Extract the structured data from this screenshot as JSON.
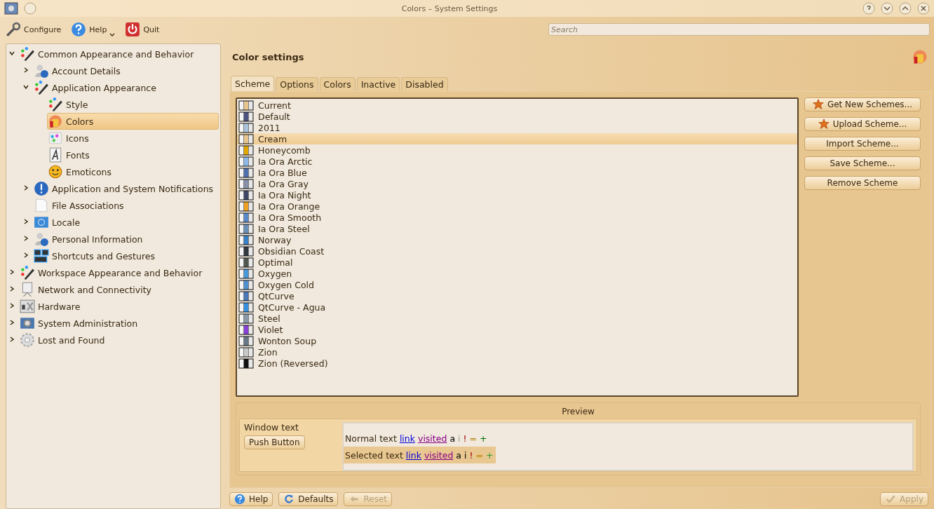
{
  "window": {
    "title": "Colors – System Settings"
  },
  "toolbar": [
    {
      "label": "Configure",
      "kind": "wrench",
      "has_menu": false
    },
    {
      "label": "Help",
      "kind": "help",
      "has_menu": true
    },
    {
      "label": "Quit",
      "kind": "power",
      "has_menu": false
    }
  ],
  "search": {
    "placeholder": "Search"
  },
  "tree": [
    {
      "label": "Common Appearance and Behavior",
      "kind": "pencil",
      "expanded": true,
      "selected": false,
      "children": [
        {
          "label": "Account Details",
          "kind": "user",
          "expanded": false,
          "selected": false
        },
        {
          "label": "Application Appearance",
          "kind": "pencil",
          "expanded": true,
          "selected": false,
          "children": [
            {
              "label": "Style",
              "kind": "pencil",
              "selected": false
            },
            {
              "label": "Colors",
              "kind": "paint",
              "selected": true
            },
            {
              "label": "Icons",
              "kind": "dots",
              "selected": false
            },
            {
              "label": "Fonts",
              "kind": "font",
              "selected": false
            },
            {
              "label": "Emoticons",
              "kind": "smiley",
              "selected": false
            }
          ]
        },
        {
          "label": "Application and System Notifications",
          "kind": "info",
          "expanded": false,
          "selected": false
        },
        {
          "label": "File Associations",
          "kind": "file",
          "selected": false
        },
        {
          "label": "Locale",
          "kind": "flag",
          "expanded": false,
          "selected": false
        },
        {
          "label": "Personal Information",
          "kind": "user",
          "expanded": false,
          "selected": false
        },
        {
          "label": "Shortcuts and Gestures",
          "kind": "keys",
          "expanded": false,
          "selected": false
        }
      ]
    },
    {
      "label": "Workspace Appearance and Behavior",
      "kind": "pencil",
      "expanded": false,
      "selected": false
    },
    {
      "label": "Network and Connectivity",
      "kind": "network",
      "expanded": false,
      "selected": false
    },
    {
      "label": "Hardware",
      "kind": "hardware",
      "expanded": false,
      "selected": false
    },
    {
      "label": "System Administration",
      "kind": "admin",
      "expanded": false,
      "selected": false
    },
    {
      "label": "Lost and Found",
      "kind": "gear",
      "expanded": false,
      "selected": false
    }
  ],
  "page": {
    "title": "Color settings"
  },
  "tabs": [
    {
      "label": "Scheme",
      "selected": true
    },
    {
      "label": "Options",
      "selected": false
    },
    {
      "label": "Colors",
      "selected": false
    },
    {
      "label": "Inactive",
      "selected": false
    },
    {
      "label": "Disabled",
      "selected": false
    }
  ],
  "schemes": [
    {
      "name": "Current",
      "color": "#e8c48c",
      "selected": false
    },
    {
      "name": "Default",
      "color": "#4a5280",
      "selected": false
    },
    {
      "name": "2011",
      "color": "#a8c4dc",
      "selected": false
    },
    {
      "name": "Cream",
      "color": "#e8c48c",
      "selected": true
    },
    {
      "name": "Honeycomb",
      "color": "#e0a800",
      "selected": false
    },
    {
      "name": "Ia Ora Arctic",
      "color": "#8cb8e8",
      "selected": false
    },
    {
      "name": "Ia Ora Blue",
      "color": "#5070b0",
      "selected": false
    },
    {
      "name": "Ia Ora Gray",
      "color": "#8890a8",
      "selected": false
    },
    {
      "name": "Ia Ora Night",
      "color": "#404868",
      "selected": false
    },
    {
      "name": "Ia Ora Orange",
      "color": "#f0a020",
      "selected": false
    },
    {
      "name": "Ia Ora Smooth",
      "color": "#5888c8",
      "selected": false
    },
    {
      "name": "Ia Ora Steel",
      "color": "#6890b8",
      "selected": false
    },
    {
      "name": "Norway",
      "color": "#3880c8",
      "selected": false
    },
    {
      "name": "Obsidian Coast",
      "color": "#303840",
      "selected": false
    },
    {
      "name": "Optimal",
      "color": "#505850",
      "selected": false
    },
    {
      "name": "Oxygen",
      "color": "#4898d8",
      "selected": false
    },
    {
      "name": "Oxygen Cold",
      "color": "#5090d0",
      "selected": false
    },
    {
      "name": "QtCurve",
      "color": "#4878b8",
      "selected": false
    },
    {
      "name": "QtCurve - Agua",
      "color": "#3890e0",
      "selected": false
    },
    {
      "name": "Steel",
      "color": "#8898a8",
      "selected": false
    },
    {
      "name": "Violet",
      "color": "#8840d8",
      "selected": false
    },
    {
      "name": "Wonton Soup",
      "color": "#687888",
      "selected": false
    },
    {
      "name": "Zion",
      "color": "#c8c8c8",
      "selected": false
    },
    {
      "name": "Zion (Reversed)",
      "color": "#101010",
      "selected": false
    }
  ],
  "scheme_buttons": [
    {
      "label": "Get New Schemes...",
      "starred": true
    },
    {
      "label": "Upload Scheme...",
      "starred": true
    },
    {
      "label": "Import Scheme...",
      "starred": false
    },
    {
      "label": "Save Scheme...",
      "starred": false
    },
    {
      "label": "Remove Scheme",
      "starred": false
    }
  ],
  "preview": {
    "title": "Preview",
    "window_text": "Window text",
    "push_button": "Push Button",
    "normal": [
      {
        "text": "Normal text",
        "kind": "plain"
      },
      {
        "text": "link",
        "kind": "link"
      },
      {
        "text": "visited",
        "kind": "visited"
      },
      {
        "text": "a",
        "kind": "active"
      },
      {
        "text": "i",
        "kind": "inactive"
      },
      {
        "text": "!",
        "kind": "negative"
      },
      {
        "text": "=",
        "kind": "neutral"
      },
      {
        "text": "+",
        "kind": "positive"
      }
    ],
    "selected": [
      {
        "text": "Selected text",
        "kind": "plain"
      },
      {
        "text": "link",
        "kind": "link"
      },
      {
        "text": "visited",
        "kind": "visited"
      },
      {
        "text": "a",
        "kind": "active"
      },
      {
        "text": "i",
        "kind": "inactive"
      },
      {
        "text": "!",
        "kind": "negative"
      },
      {
        "text": "=",
        "kind": "neutral"
      },
      {
        "text": "+",
        "kind": "positive"
      }
    ]
  },
  "footer_left": [
    {
      "label": "Help",
      "kind": "help",
      "disabled": false
    },
    {
      "label": "Defaults",
      "kind": "refresh",
      "disabled": false
    },
    {
      "label": "Reset",
      "kind": "back",
      "disabled": true
    }
  ],
  "footer_right": [
    {
      "label": "Apply",
      "kind": "check",
      "disabled": true
    }
  ]
}
